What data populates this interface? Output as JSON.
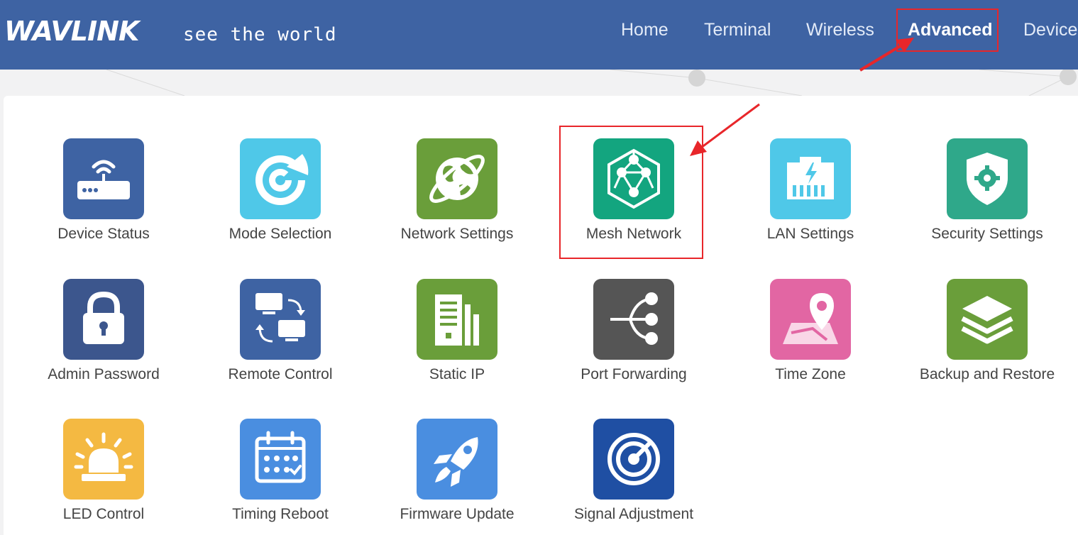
{
  "header": {
    "brand": "WAVLINK",
    "tagline": "see the world",
    "nav": [
      {
        "label": "Home",
        "active": false
      },
      {
        "label": "Terminal",
        "active": false
      },
      {
        "label": "Wireless",
        "active": false
      },
      {
        "label": "Advanced",
        "active": true
      },
      {
        "label": "Device",
        "active": false
      }
    ]
  },
  "colors": {
    "header_bg": "#3e63a3",
    "highlight": "#e8262a"
  },
  "tiles": [
    {
      "label": "Device Status",
      "icon": "router-icon",
      "color": "#3e63a3"
    },
    {
      "label": "Mode Selection",
      "icon": "radar-mode-icon",
      "color": "#4fc8e8"
    },
    {
      "label": "Network Settings",
      "icon": "globe-icon",
      "color": "#6a9e3a"
    },
    {
      "label": "Mesh Network",
      "icon": "mesh-hexagon-icon",
      "color": "#13a57f"
    },
    {
      "label": "LAN Settings",
      "icon": "ethernet-port-icon",
      "color": "#4fc8e8"
    },
    {
      "label": "Security Settings",
      "icon": "shield-gear-icon",
      "color": "#2fa88a"
    },
    {
      "label": "Admin Password",
      "icon": "lock-icon",
      "color": "#3c568d"
    },
    {
      "label": "Remote Control",
      "icon": "remote-computers-icon",
      "color": "#3e63a3"
    },
    {
      "label": "Static IP",
      "icon": "server-icon",
      "color": "#6a9e3a"
    },
    {
      "label": "Port Forwarding",
      "icon": "share-icon",
      "color": "#555555"
    },
    {
      "label": "Time Zone",
      "icon": "map-pin-icon",
      "color": "#e266a3"
    },
    {
      "label": "Backup and Restore",
      "icon": "layers-icon",
      "color": "#6a9e3a"
    },
    {
      "label": "LED Control",
      "icon": "alarm-light-icon",
      "color": "#f4b942"
    },
    {
      "label": "Timing Reboot",
      "icon": "calendar-icon",
      "color": "#4a8ee0"
    },
    {
      "label": "Firmware Update",
      "icon": "rocket-icon",
      "color": "#4a8ee0"
    },
    {
      "label": "Signal Adjustment",
      "icon": "signal-gauge-icon",
      "color": "#1f4fa3"
    }
  ]
}
